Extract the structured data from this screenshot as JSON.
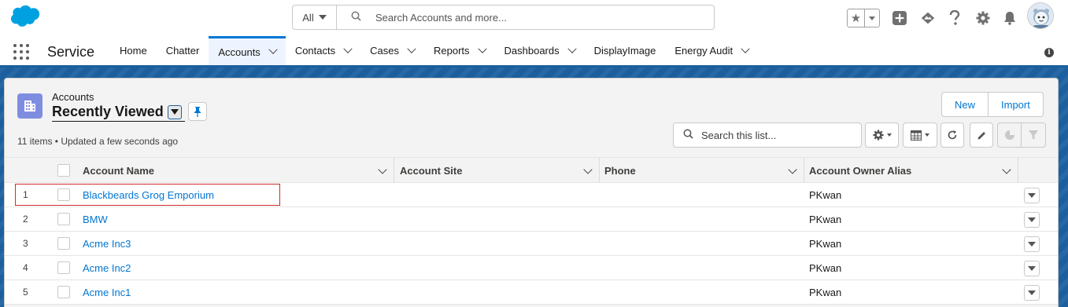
{
  "global_header": {
    "search_scope": "All",
    "search_placeholder": "Search Accounts and more..."
  },
  "context_bar": {
    "app_name": "Service",
    "tabs": [
      {
        "label": "Home",
        "dropdown": false
      },
      {
        "label": "Chatter",
        "dropdown": false
      },
      {
        "label": "Accounts",
        "dropdown": true,
        "active": true
      },
      {
        "label": "Contacts",
        "dropdown": true
      },
      {
        "label": "Cases",
        "dropdown": true
      },
      {
        "label": "Reports",
        "dropdown": true
      },
      {
        "label": "Dashboards",
        "dropdown": true
      },
      {
        "label": "DisplayImage",
        "dropdown": false
      },
      {
        "label": "Energy Audit",
        "dropdown": true
      }
    ]
  },
  "list_view": {
    "object_label": "Accounts",
    "view_name": "Recently Viewed",
    "meta": "11 items • Updated a few seconds ago",
    "new_button": "New",
    "import_button": "Import",
    "search_placeholder": "Search this list..."
  },
  "table": {
    "columns": [
      "Account Name",
      "Account Site",
      "Phone",
      "Account Owner Alias"
    ],
    "rows": [
      {
        "num": "1",
        "name": "Blackbeards Grog Emporium",
        "owner": "PKwan"
      },
      {
        "num": "2",
        "name": "BMW",
        "owner": "PKwan"
      },
      {
        "num": "3",
        "name": "Acme Inc3",
        "owner": "PKwan"
      },
      {
        "num": "4",
        "name": "Acme Inc2",
        "owner": "PKwan"
      },
      {
        "num": "5",
        "name": "Acme Inc1",
        "owner": "PKwan"
      }
    ]
  },
  "colors": {
    "brand_blue": "#0176d3",
    "header_band": "#1b5f9e",
    "object_icon": "#7f8de1",
    "highlight_box": "#d12a2a"
  }
}
